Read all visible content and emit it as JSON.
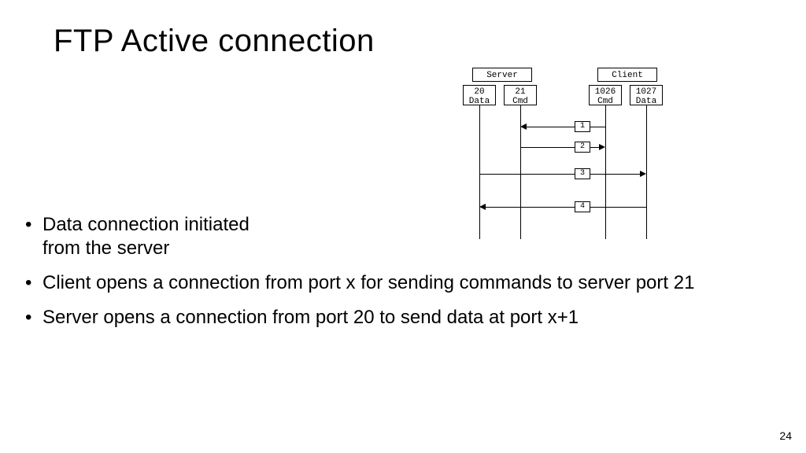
{
  "title": "FTP Active connection",
  "bullets": [
    "Data connection initiated from the server",
    "Client opens a connection from port x for sending commands to server port 21",
    "Server opens a connection from port 20 to send data at port x+1"
  ],
  "page_number": "24",
  "diagram": {
    "headers": {
      "server": "Server",
      "client": "Client"
    },
    "ports": {
      "server_data": {
        "num": "20",
        "lbl": "Data"
      },
      "server_cmd": {
        "num": "21",
        "lbl": "Cmd"
      },
      "client_cmd": {
        "num": "1026",
        "lbl": "Cmd"
      },
      "client_data": {
        "num": "1027",
        "lbl": "Data"
      }
    },
    "messages": {
      "m1": "1",
      "m2": "2",
      "m3": "3",
      "m4": "4"
    }
  }
}
